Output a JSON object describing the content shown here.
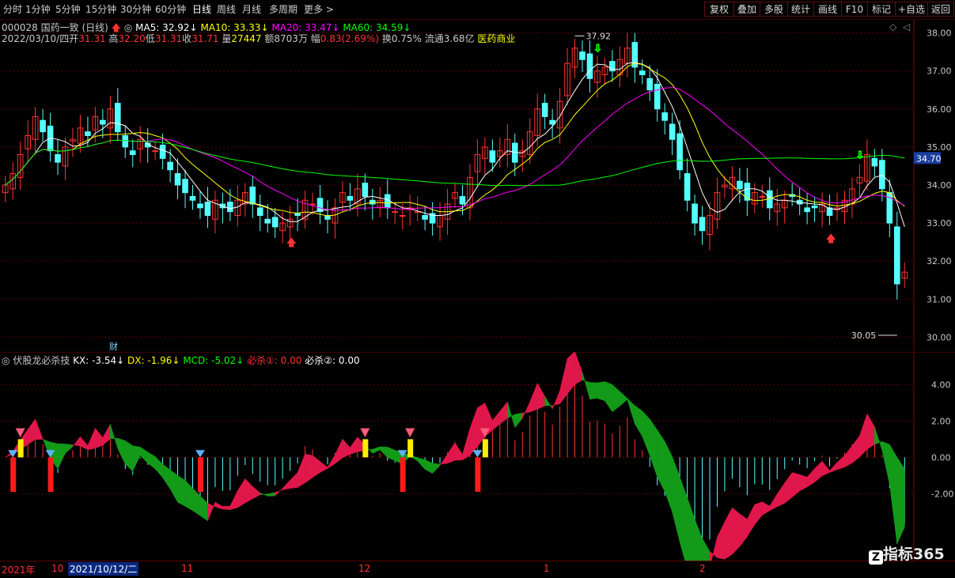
{
  "toolbar": {
    "periods": [
      "分时",
      "1分钟",
      "5分钟",
      "15分钟",
      "30分钟",
      "60分钟",
      "日线",
      "周线",
      "月线",
      "多周期",
      "更多"
    ],
    "right_buttons": [
      "复权",
      "叠加",
      "多股",
      "统计",
      "画线",
      "F10",
      "标记",
      "+自选",
      "返回"
    ]
  },
  "header": {
    "code_name": "000028 国药一致 (日线)",
    "ma5": "MA5: 32.92",
    "ma10": "MA10: 33.33",
    "ma20": "MA20: 33.47",
    "ma60": "MA60: 34.59",
    "date": "2022/03/10/四",
    "open_label": "开",
    "open": "31.31",
    "high_label": "高",
    "high": "32.20",
    "low_label": "低",
    "low": "31.31",
    "close_label": "收",
    "close": "31.71",
    "vol_label": "量",
    "vol": "27447",
    "amount": "额8703万",
    "change_label": "幅",
    "change": "0.83(2.69%)",
    "turnover": "换0.75%",
    "float": "流通3.68亿",
    "sector": "医药商业"
  },
  "main_axis": {
    "ticks": [
      38.0,
      37.0,
      36.0,
      35.0,
      34.0,
      33.0,
      32.0,
      31.0,
      30.0
    ],
    "ylim": [
      29.8,
      38.2
    ],
    "current_price_tag": "34.70",
    "high_marker": "37.92",
    "low_marker": "30.05",
    "cai_marker": "财"
  },
  "indicator": {
    "name": "伏股龙必杀技",
    "kx": "KX: -3.54",
    "dx": "DX: -1.96",
    "mcd": "MCD: -5.02",
    "bisha1": "必杀①: 0.00",
    "bisha2": "必杀②: 0.00",
    "ticks": [
      "4.00",
      "2.00",
      "0.00",
      "-2.00"
    ],
    "ylim": [
      -5.6,
      5.2
    ]
  },
  "timeline": {
    "labels": [
      "2021年",
      "10",
      "2021/10/12/二",
      "11",
      "12",
      "1",
      "2"
    ]
  },
  "watermark": "指标365",
  "colors": {
    "up": "#ff3232",
    "down": "#54ffff",
    "ma5": "#ffffff",
    "ma10": "#ffff00",
    "ma20": "#ff00ff",
    "ma60": "#00ff00"
  },
  "chart_data": {
    "type": "candlestick",
    "ohlc_close_approx": [
      34.0,
      34.3,
      34.8,
      35.3,
      35.8,
      35.4,
      34.9,
      34.6,
      35.0,
      35.2,
      35.5,
      35.3,
      35.8,
      35.6,
      36.0,
      35.4,
      35.0,
      34.8,
      35.2,
      35.0,
      34.9,
      34.7,
      34.4,
      34.0,
      33.8,
      33.6,
      33.4,
      33.2,
      33.6,
      33.4,
      33.3,
      33.6,
      33.8,
      33.5,
      33.2,
      33.0,
      32.9,
      33.0,
      33.1,
      33.2,
      33.6,
      33.5,
      33.3,
      33.1,
      33.4,
      33.8,
      33.6,
      33.9,
      33.7,
      33.5,
      33.6,
      33.4,
      33.3,
      33.2,
      33.4,
      33.3,
      33.1,
      33.0,
      33.2,
      33.5,
      33.8,
      33.5,
      34.2,
      34.8,
      35.0,
      34.6,
      34.9,
      35.2,
      34.6,
      34.9,
      35.4,
      36.0,
      35.8,
      35.6,
      36.2,
      37.2,
      37.6,
      37.3,
      36.8,
      37.0,
      37.1,
      37.0,
      37.3,
      37.6,
      37.1,
      36.9,
      36.5,
      36.0,
      35.7,
      35.2,
      34.4,
      33.6,
      33.0,
      32.8,
      33.2,
      33.8,
      34.0,
      34.2,
      33.9,
      33.6,
      33.8,
      33.7,
      33.4,
      33.5,
      33.6,
      33.7,
      33.5,
      33.3,
      33.4,
      33.5,
      33.2,
      33.4,
      33.6,
      33.9,
      34.2,
      34.8,
      34.5,
      33.9,
      33.0,
      31.4,
      31.71
    ]
  }
}
